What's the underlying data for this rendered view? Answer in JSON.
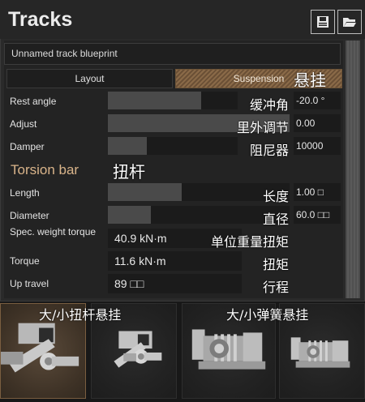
{
  "window": {
    "title": "Tracks"
  },
  "toolbar": {
    "save_icon": "save-icon",
    "open_icon": "folder-open-icon"
  },
  "blueprint": {
    "name": "Unnamed track blueprint"
  },
  "tabs": [
    {
      "label": "Layout",
      "active": false
    },
    {
      "label": "Suspension",
      "active": true,
      "annotation": "悬挂"
    }
  ],
  "general": [
    {
      "label": "Rest angle",
      "annotation": "缓冲角",
      "value": "-20.0 °",
      "level": 0.5
    },
    {
      "label": "Adjust",
      "annotation": "里外调节",
      "value": "0.00",
      "level": 1.0
    },
    {
      "label": "Damper",
      "annotation": "阻尼器",
      "value": "10000",
      "level": 0.2
    }
  ],
  "torsion_bar": {
    "title": "Torsion bar",
    "annotation": "扭杆",
    "sliders": [
      {
        "label": "Length",
        "annotation": "长度",
        "value": "1.00 □",
        "level": 0.4
      },
      {
        "label": "Diameter",
        "annotation": "直径",
        "value": "60.0 □□",
        "level": 0.23
      }
    ],
    "readouts": [
      {
        "label": "Spec. weight torque",
        "annotation": "单位重量扭矩",
        "value": "40.9 kN·m"
      },
      {
        "label": "Torque",
        "annotation": "扭矩",
        "value": "11.6 kN·m"
      },
      {
        "label": "Up travel",
        "annotation": "行程",
        "value": "89 □□"
      }
    ]
  },
  "presets": {
    "annotations": [
      "大/小扭杆悬挂",
      "大/小弹簧悬挂"
    ],
    "items": [
      {
        "icon": "large-torsion-bar-icon",
        "selected": true
      },
      {
        "icon": "small-torsion-bar-icon",
        "selected": false
      },
      {
        "icon": "large-spring-suspension-icon",
        "selected": false
      },
      {
        "icon": "small-spring-suspension-icon",
        "selected": false
      }
    ]
  },
  "colors": {
    "accent": "#d9b48a",
    "tab_active": "#8a6a48",
    "panel": "#2a2a2a"
  }
}
